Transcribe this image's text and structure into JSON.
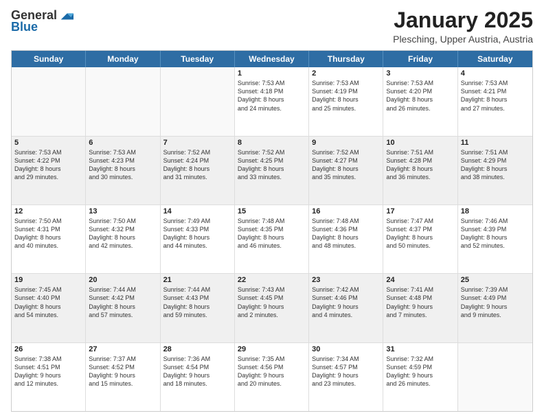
{
  "header": {
    "logo_general": "General",
    "logo_blue": "Blue",
    "title": "January 2025",
    "location": "Plesching, Upper Austria, Austria"
  },
  "weekdays": [
    "Sunday",
    "Monday",
    "Tuesday",
    "Wednesday",
    "Thursday",
    "Friday",
    "Saturday"
  ],
  "rows": [
    [
      {
        "day": "",
        "text": "",
        "empty": true
      },
      {
        "day": "",
        "text": "",
        "empty": true
      },
      {
        "day": "",
        "text": "",
        "empty": true
      },
      {
        "day": "1",
        "text": "Sunrise: 7:53 AM\nSunset: 4:18 PM\nDaylight: 8 hours\nand 24 minutes."
      },
      {
        "day": "2",
        "text": "Sunrise: 7:53 AM\nSunset: 4:19 PM\nDaylight: 8 hours\nand 25 minutes."
      },
      {
        "day": "3",
        "text": "Sunrise: 7:53 AM\nSunset: 4:20 PM\nDaylight: 8 hours\nand 26 minutes."
      },
      {
        "day": "4",
        "text": "Sunrise: 7:53 AM\nSunset: 4:21 PM\nDaylight: 8 hours\nand 27 minutes."
      }
    ],
    [
      {
        "day": "5",
        "text": "Sunrise: 7:53 AM\nSunset: 4:22 PM\nDaylight: 8 hours\nand 29 minutes.",
        "shaded": true
      },
      {
        "day": "6",
        "text": "Sunrise: 7:53 AM\nSunset: 4:23 PM\nDaylight: 8 hours\nand 30 minutes.",
        "shaded": true
      },
      {
        "day": "7",
        "text": "Sunrise: 7:52 AM\nSunset: 4:24 PM\nDaylight: 8 hours\nand 31 minutes.",
        "shaded": true
      },
      {
        "day": "8",
        "text": "Sunrise: 7:52 AM\nSunset: 4:25 PM\nDaylight: 8 hours\nand 33 minutes.",
        "shaded": true
      },
      {
        "day": "9",
        "text": "Sunrise: 7:52 AM\nSunset: 4:27 PM\nDaylight: 8 hours\nand 35 minutes.",
        "shaded": true
      },
      {
        "day": "10",
        "text": "Sunrise: 7:51 AM\nSunset: 4:28 PM\nDaylight: 8 hours\nand 36 minutes.",
        "shaded": true
      },
      {
        "day": "11",
        "text": "Sunrise: 7:51 AM\nSunset: 4:29 PM\nDaylight: 8 hours\nand 38 minutes.",
        "shaded": true
      }
    ],
    [
      {
        "day": "12",
        "text": "Sunrise: 7:50 AM\nSunset: 4:31 PM\nDaylight: 8 hours\nand 40 minutes."
      },
      {
        "day": "13",
        "text": "Sunrise: 7:50 AM\nSunset: 4:32 PM\nDaylight: 8 hours\nand 42 minutes."
      },
      {
        "day": "14",
        "text": "Sunrise: 7:49 AM\nSunset: 4:33 PM\nDaylight: 8 hours\nand 44 minutes."
      },
      {
        "day": "15",
        "text": "Sunrise: 7:48 AM\nSunset: 4:35 PM\nDaylight: 8 hours\nand 46 minutes."
      },
      {
        "day": "16",
        "text": "Sunrise: 7:48 AM\nSunset: 4:36 PM\nDaylight: 8 hours\nand 48 minutes."
      },
      {
        "day": "17",
        "text": "Sunrise: 7:47 AM\nSunset: 4:37 PM\nDaylight: 8 hours\nand 50 minutes."
      },
      {
        "day": "18",
        "text": "Sunrise: 7:46 AM\nSunset: 4:39 PM\nDaylight: 8 hours\nand 52 minutes."
      }
    ],
    [
      {
        "day": "19",
        "text": "Sunrise: 7:45 AM\nSunset: 4:40 PM\nDaylight: 8 hours\nand 54 minutes.",
        "shaded": true
      },
      {
        "day": "20",
        "text": "Sunrise: 7:44 AM\nSunset: 4:42 PM\nDaylight: 8 hours\nand 57 minutes.",
        "shaded": true
      },
      {
        "day": "21",
        "text": "Sunrise: 7:44 AM\nSunset: 4:43 PM\nDaylight: 8 hours\nand 59 minutes.",
        "shaded": true
      },
      {
        "day": "22",
        "text": "Sunrise: 7:43 AM\nSunset: 4:45 PM\nDaylight: 9 hours\nand 2 minutes.",
        "shaded": true
      },
      {
        "day": "23",
        "text": "Sunrise: 7:42 AM\nSunset: 4:46 PM\nDaylight: 9 hours\nand 4 minutes.",
        "shaded": true
      },
      {
        "day": "24",
        "text": "Sunrise: 7:41 AM\nSunset: 4:48 PM\nDaylight: 9 hours\nand 7 minutes.",
        "shaded": true
      },
      {
        "day": "25",
        "text": "Sunrise: 7:39 AM\nSunset: 4:49 PM\nDaylight: 9 hours\nand 9 minutes.",
        "shaded": true
      }
    ],
    [
      {
        "day": "26",
        "text": "Sunrise: 7:38 AM\nSunset: 4:51 PM\nDaylight: 9 hours\nand 12 minutes."
      },
      {
        "day": "27",
        "text": "Sunrise: 7:37 AM\nSunset: 4:52 PM\nDaylight: 9 hours\nand 15 minutes."
      },
      {
        "day": "28",
        "text": "Sunrise: 7:36 AM\nSunset: 4:54 PM\nDaylight: 9 hours\nand 18 minutes."
      },
      {
        "day": "29",
        "text": "Sunrise: 7:35 AM\nSunset: 4:56 PM\nDaylight: 9 hours\nand 20 minutes."
      },
      {
        "day": "30",
        "text": "Sunrise: 7:34 AM\nSunset: 4:57 PM\nDaylight: 9 hours\nand 23 minutes."
      },
      {
        "day": "31",
        "text": "Sunrise: 7:32 AM\nSunset: 4:59 PM\nDaylight: 9 hours\nand 26 minutes."
      },
      {
        "day": "",
        "text": "",
        "empty": true
      }
    ]
  ]
}
